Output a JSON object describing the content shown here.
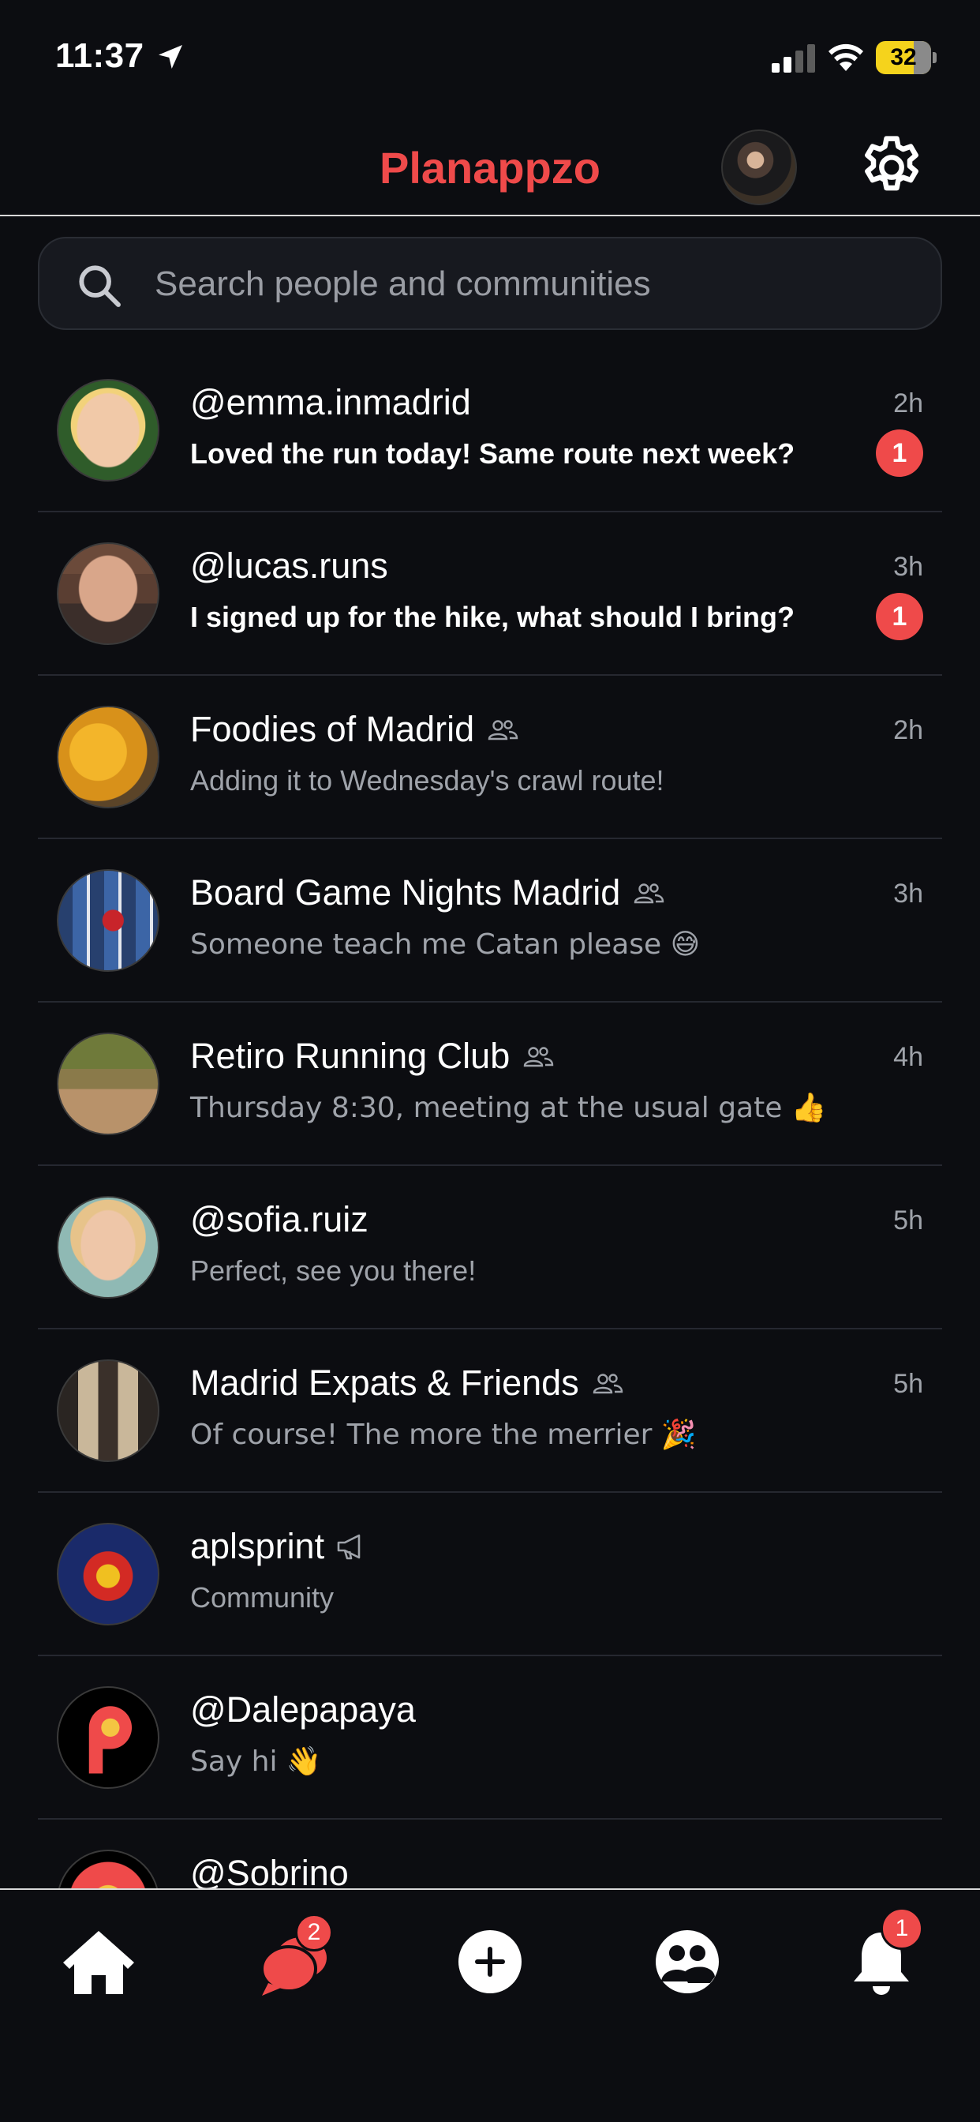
{
  "status_bar": {
    "time": "11:37",
    "battery": "32"
  },
  "header": {
    "title": "Planappzo"
  },
  "search": {
    "placeholder": "Search people and communities"
  },
  "chats": [
    {
      "name": "@emma.inmadrid",
      "message": "Loved the run today! Same route next week?",
      "time": "2h",
      "unread": "1"
    },
    {
      "name": "@lucas.runs",
      "message": "I signed up for the hike, what should I bring?",
      "time": "3h",
      "unread": "1"
    },
    {
      "name": "Foodies of Madrid",
      "message": "Adding it to Wednesday's crawl route!",
      "time": "2h",
      "kind": "group"
    },
    {
      "name": "Board Game Nights Madrid",
      "message": "Someone teach me Catan please 😅",
      "time": "3h",
      "kind": "group"
    },
    {
      "name": "Retiro Running Club",
      "message": "Thursday 8:30, meeting at the usual gate 👍",
      "time": "4h",
      "kind": "group"
    },
    {
      "name": "@sofia.ruiz",
      "message": "Perfect, see you there!",
      "time": "5h"
    },
    {
      "name": "Madrid Expats & Friends",
      "message": "Of course! The more the merrier 🎉",
      "time": "5h",
      "kind": "group"
    },
    {
      "name": "aplsprint",
      "message": "Community",
      "kind": "announcement"
    },
    {
      "name": "@Dalepapaya",
      "message": "Say hi 👋"
    },
    {
      "name": "@Sobrino",
      "message": ""
    }
  ],
  "tabbar": {
    "home_icon": "home-icon",
    "chats_icon": "chat-bubbles-icon",
    "chats_badge": "2",
    "create_icon": "plus-circle-icon",
    "communities_icon": "people-icon",
    "notifications_icon": "bell-icon",
    "notifications_badge": "1"
  },
  "colors": {
    "accent": "#ef4a4a",
    "background": "#0c0d11"
  }
}
